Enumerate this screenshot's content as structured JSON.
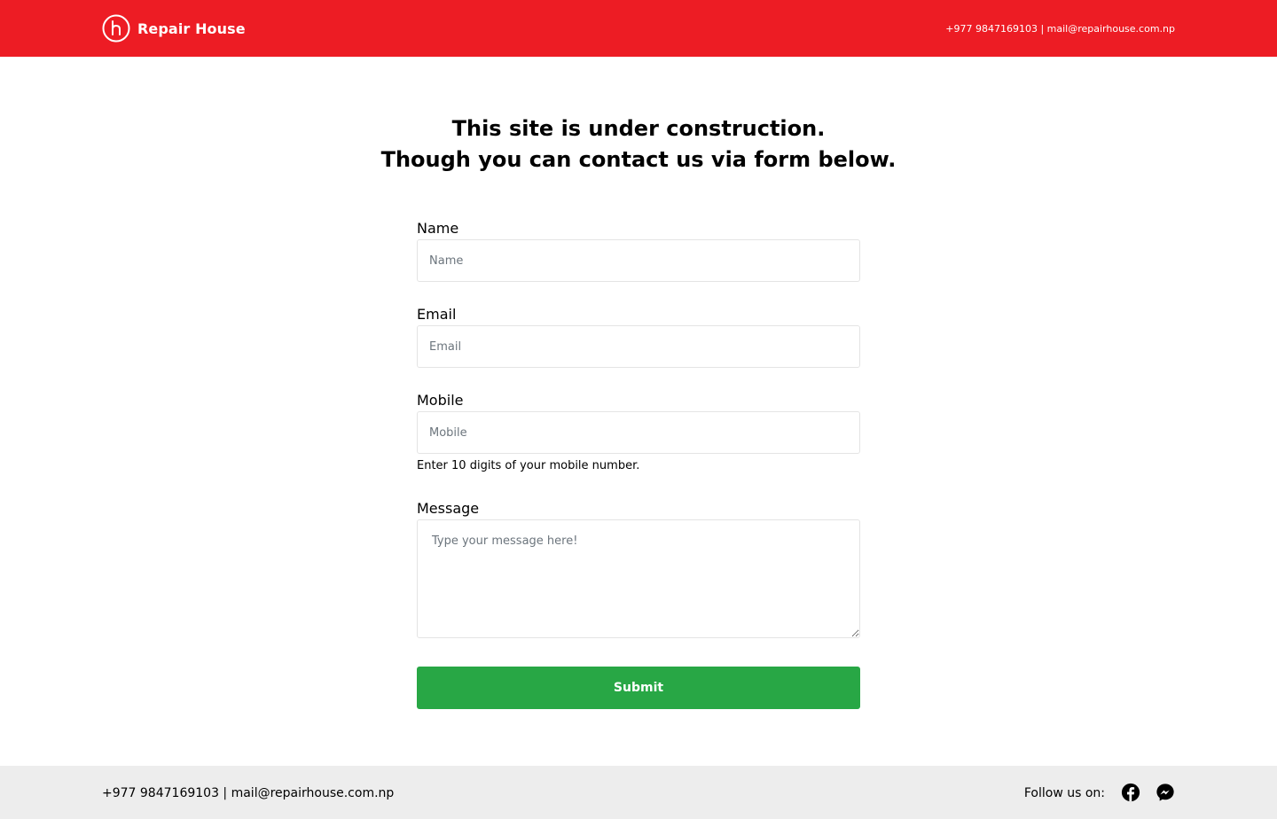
{
  "brand": {
    "name": "Repair House"
  },
  "header": {
    "contact": "+977 9847169103 | mail@repairhouse.com.np"
  },
  "main": {
    "heading_line1": "This site is under construction.",
    "heading_line2": "Though you can contact us via form below."
  },
  "form": {
    "name": {
      "label": "Name",
      "placeholder": "Name",
      "value": ""
    },
    "email": {
      "label": "Email",
      "placeholder": "Email",
      "value": ""
    },
    "mobile": {
      "label": "Mobile",
      "placeholder": "Mobile",
      "value": "",
      "help": "Enter 10 digits of your mobile number."
    },
    "message": {
      "label": "Message",
      "placeholder": "Type your message here!",
      "value": ""
    },
    "submit_label": "Submit"
  },
  "footer": {
    "contact": "+977 9847169103 | mail@repairhouse.com.np",
    "follow_label": "Follow us on:",
    "social": [
      {
        "icon": "facebook-icon"
      },
      {
        "icon": "messenger-icon"
      }
    ]
  },
  "colors": {
    "brand_red": "#ed1c24",
    "submit_green": "#28a745",
    "footer_bg": "#ededed"
  }
}
